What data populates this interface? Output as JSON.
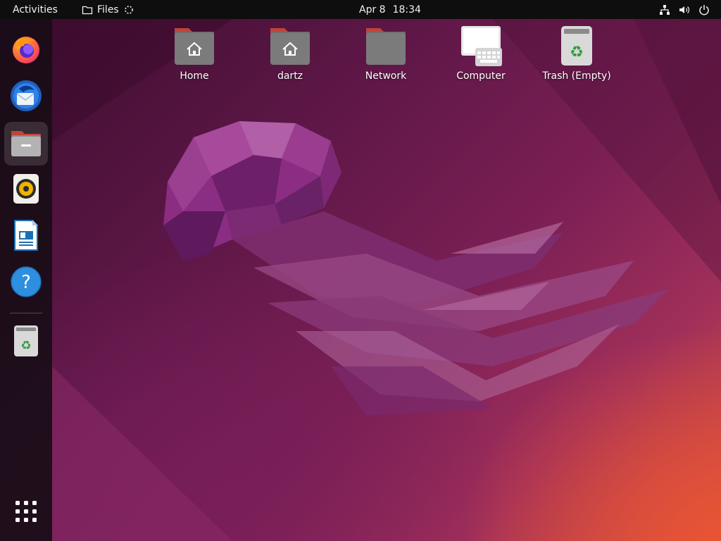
{
  "topbar": {
    "activities_label": "Activities",
    "app_name": "Files",
    "date": "Apr 8",
    "time": "18:34",
    "tray_icons": [
      "network-wired-icon",
      "volume-icon",
      "power-icon"
    ]
  },
  "dock": {
    "apps": [
      {
        "id": "firefox",
        "icon": "firefox-icon"
      },
      {
        "id": "thunderbird",
        "icon": "thunderbird-icon"
      },
      {
        "id": "files",
        "icon": "folder-icon",
        "active": true
      },
      {
        "id": "rhythmbox",
        "icon": "speaker-icon"
      },
      {
        "id": "libreoffice-writer",
        "icon": "writer-document-icon"
      },
      {
        "id": "help",
        "icon": "help-icon"
      },
      {
        "id": "trash",
        "icon": "trash-icon"
      }
    ],
    "show_apps_icon": "app-grid-icon"
  },
  "desktop": {
    "icons": [
      {
        "label": "Home",
        "icon": "home-folder-icon"
      },
      {
        "label": "dartz",
        "icon": "home-folder-icon"
      },
      {
        "label": "Network",
        "icon": "network-folder-icon"
      },
      {
        "label": "Computer",
        "icon": "computer-icon"
      },
      {
        "label": "Trash (Empty)",
        "icon": "trash-icon"
      }
    ]
  },
  "colors": {
    "topbar_bg": "#0e0e0e",
    "dock_bg": "#160c14",
    "folder_body": "#6b6b6b",
    "folder_tab": "#c0443a",
    "wallpaper_dark": "#3b0d2e",
    "wallpaper_orange": "#d9503e"
  }
}
